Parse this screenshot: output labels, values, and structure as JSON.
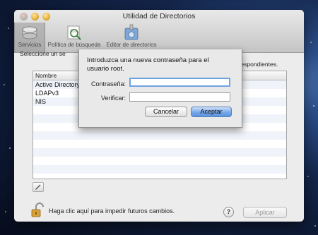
{
  "window": {
    "title": "Utilidad de Directorios"
  },
  "toolbar": {
    "items": [
      {
        "label": "Servicios",
        "icon": "services-icon",
        "selected": true
      },
      {
        "label": "Política de búsqueda",
        "icon": "search-policy-icon",
        "selected": false
      },
      {
        "label": "Editor de directorios",
        "icon": "directory-editor-icon",
        "selected": false
      }
    ]
  },
  "main": {
    "intro_left": "Seleccione un se",
    "intro_right": "orrespondientes.",
    "table": {
      "header": "Nombre",
      "rows": [
        "Active Directory",
        "LDAPv3",
        "NIS"
      ]
    }
  },
  "footer": {
    "lock_text": "Haga clic aquí para impedir futuros cambios.",
    "help_label": "?",
    "apply_label": "Aplicar"
  },
  "dialog": {
    "message": "Introduzca una nueva contraseña para el usuario root.",
    "password_label": "Contraseña:",
    "password_value": "",
    "verify_label": "Verificar:",
    "verify_value": "",
    "cancel_label": "Cancelar",
    "ok_label": "Aceptar"
  },
  "colors": {
    "accent": "#5c93e0",
    "focus_ring": "#6fa3e3"
  }
}
